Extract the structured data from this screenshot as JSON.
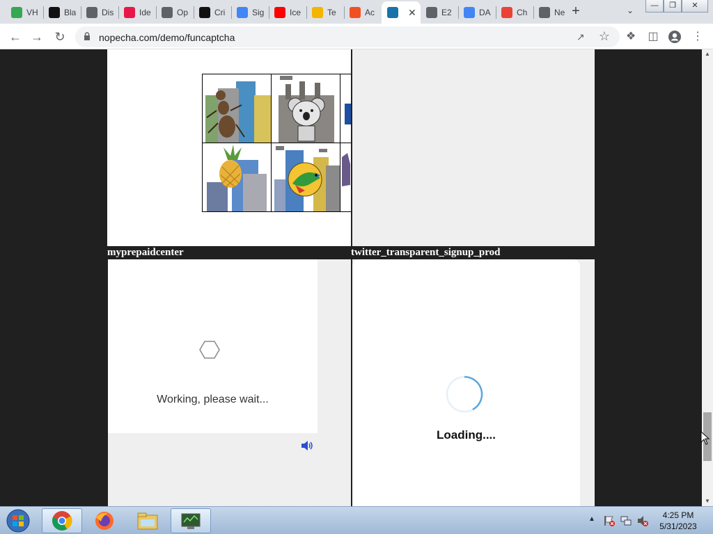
{
  "tabs": [
    {
      "title": "VH",
      "icon": "play-store-icon",
      "color": "#34a853"
    },
    {
      "title": "Bla",
      "icon": "ddd-icon",
      "color": "#111111"
    },
    {
      "title": "Dis",
      "icon": "globe-icon",
      "color": "#5f6368"
    },
    {
      "title": "Ide",
      "icon": "ide-icon",
      "color": "#e8174a"
    },
    {
      "title": "Op",
      "icon": "globe-icon",
      "color": "#5f6368"
    },
    {
      "title": "Cri",
      "icon": "medium-icon",
      "color": "#111111"
    },
    {
      "title": "Sig",
      "icon": "google-icon",
      "color": "#4285f4"
    },
    {
      "title": "Ice",
      "icon": "youtube-icon",
      "color": "#ff0000"
    },
    {
      "title": "Te",
      "icon": "hand-icon",
      "color": "#f4b400"
    },
    {
      "title": "Ac",
      "icon": "microsoft-icon",
      "color": "#f25022"
    },
    {
      "title": "",
      "icon": "robot-icon",
      "color": "#1a73a8",
      "active": true
    },
    {
      "title": "E2",
      "icon": "globe-icon",
      "color": "#5f6368"
    },
    {
      "title": "DA",
      "icon": "google-icon",
      "color": "#4285f4"
    },
    {
      "title": "Ch",
      "icon": "rainbow-icon",
      "color": "#ea4335"
    },
    {
      "title": "Ne",
      "icon": "chromium-icon",
      "color": "#5f6368"
    }
  ],
  "new_tab_label": "+",
  "address": {
    "url": "nopecha.com/demo/funcaptcha"
  },
  "panels": {
    "top_left_label": "myprepaidcenter",
    "top_right_label": "twitter_transparent_signup_prod",
    "working_text": "Working, please wait...",
    "loading_text": "Loading...."
  },
  "captcha_cells": [
    {
      "subject": "ant",
      "color": "#6b4b2e"
    },
    {
      "subject": "koala",
      "color": "#8a8a8a"
    },
    {
      "subject": "partial",
      "color": "#1e4fa0"
    },
    {
      "subject": "pineapple",
      "color": "#e8b23a"
    },
    {
      "subject": "parrot",
      "color": "#f4c432"
    },
    {
      "subject": "partial-cat",
      "color": "#6a5a8a"
    }
  ],
  "taskbar": {
    "clock_time": "4:25 PM",
    "clock_date": "5/31/2023",
    "items": [
      "chrome-icon",
      "firefox-icon",
      "file-explorer-icon",
      "monitor-app-icon"
    ]
  },
  "colors": {
    "accent": "#1a73e8",
    "tab_strip": "#dee1e6"
  }
}
